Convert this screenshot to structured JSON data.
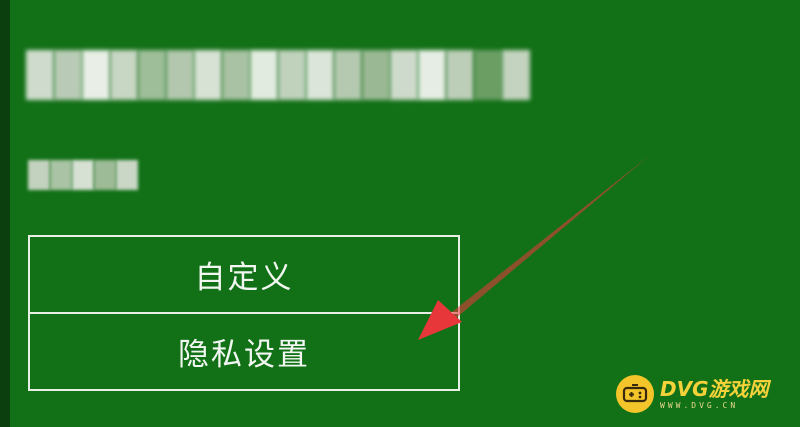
{
  "screen": {
    "background_color": "#127117",
    "border_color": "#e7efe6",
    "text_color": "#f2f6f1"
  },
  "redacted": {
    "title_pixel_colors": [
      "#cfdccd",
      "#b9cbb6",
      "#e9efe7",
      "#c8d6c4",
      "#9ebd99",
      "#b2c7ad",
      "#d7e2d4",
      "#a8c2a3",
      "#e2ebe0",
      "#c0d1bc",
      "#dbe5d9",
      "#b4c9b0",
      "#9ab894",
      "#cedacb",
      "#e6ede4",
      "#bccdb8",
      "#6a9e63",
      "#c3d3bf"
    ],
    "subtitle_pixel_colors": [
      "#c2d2be",
      "#a9c3a4",
      "#d6e0d3",
      "#9dbb97",
      "#cad7c6"
    ]
  },
  "menu": {
    "items": [
      {
        "label": "自定义"
      },
      {
        "label": "隐私设置"
      }
    ]
  },
  "annotation": {
    "arrow_color": "#e8373b",
    "arrow_target": "隐私设置"
  },
  "watermark": {
    "brand": "DVG游戏网",
    "url": "WWW.DVG.CN",
    "logo_icon": "gamepad-icon",
    "brand_color": "#f5d23a"
  }
}
